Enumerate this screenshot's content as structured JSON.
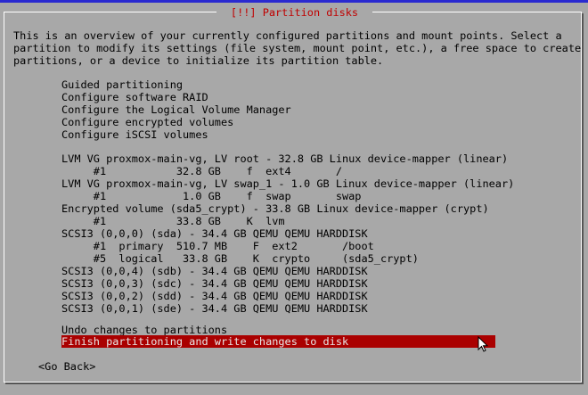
{
  "dialog": {
    "title": "[!!] Partition disks",
    "intro_lines": [
      "This is an overview of your currently configured partitions and mount points. Select a",
      "partition to modify its settings (file system, mount point, etc.), a free space to create",
      "partitions, or a device to initialize its partition table."
    ]
  },
  "menu": {
    "guided": "Guided partitioning",
    "raid": "Configure software RAID",
    "lvm": "Configure the Logical Volume Manager",
    "encrypted": "Configure encrypted volumes",
    "iscsi": "Configure iSCSI volumes",
    "lvm_root": "LVM VG proxmox-main-vg, LV root - 32.8 GB Linux device-mapper (linear)",
    "lvm_root_part": "     #1           32.8 GB    f  ext4       /",
    "lvm_swap": "LVM VG proxmox-main-vg, LV swap_1 - 1.0 GB Linux device-mapper (linear)",
    "lvm_swap_part": "     #1            1.0 GB    f  swap       swap",
    "crypt": "Encrypted volume (sda5_crypt) - 33.8 GB Linux device-mapper (crypt)",
    "crypt_part": "     #1           33.8 GB    K  lvm",
    "sda": "SCSI3 (0,0,0) (sda) - 34.4 GB QEMU QEMU HARDDISK",
    "sda1": "     #1  primary  510.7 MB    F  ext2       /boot",
    "sda5": "     #5  logical   33.8 GB    K  crypto     (sda5_crypt)",
    "sdb": "SCSI3 (0,0,4) (sdb) - 34.4 GB QEMU QEMU HARDDISK",
    "sdc": "SCSI3 (0,0,3) (sdc) - 34.4 GB QEMU QEMU HARDDISK",
    "sdd": "SCSI3 (0,0,2) (sdd) - 34.4 GB QEMU QEMU HARDDISK",
    "sde": "SCSI3 (0,0,1) (sde) - 34.4 GB QEMU QEMU HARDDISK",
    "undo": "Undo changes to partitions",
    "finish": "Finish partitioning and write changes to disk"
  },
  "buttons": {
    "go_back": "<Go Back>"
  },
  "colors": {
    "background": "#a8a8a8",
    "title": "#c00000",
    "selection": "#aa0000",
    "top_strip": "#2a2ad0"
  }
}
